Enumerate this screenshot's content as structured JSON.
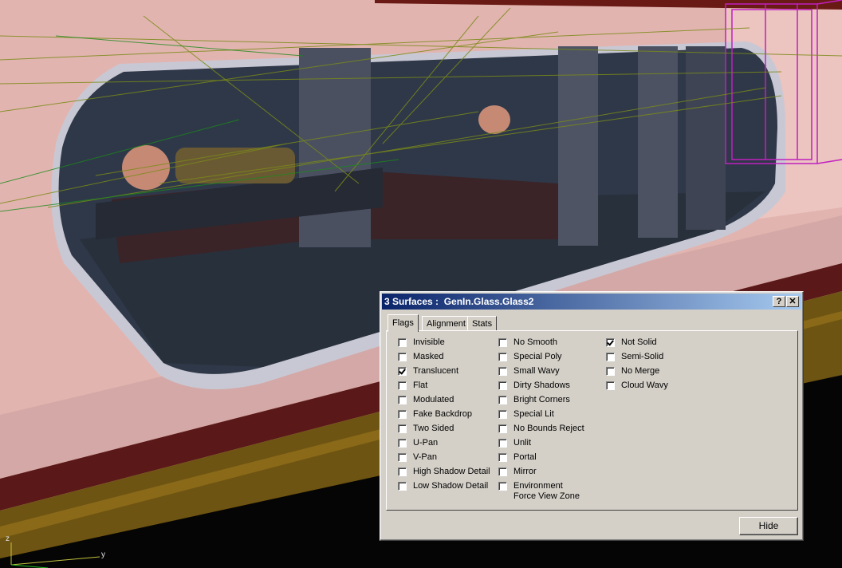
{
  "dialog": {
    "title": "3 Surfaces :  GenIn.Glass.Glass2",
    "help_glyph": "?",
    "close_glyph": "✕",
    "tabs": [
      {
        "label": "Flags",
        "active": true
      },
      {
        "label": "Alignment",
        "active": false
      },
      {
        "label": "Stats",
        "active": false
      }
    ],
    "flags": {
      "column1": [
        {
          "label": "Invisible",
          "checked": false
        },
        {
          "label": "Masked",
          "checked": false
        },
        {
          "label": "Translucent",
          "checked": true
        },
        {
          "label": "Flat",
          "checked": false
        },
        {
          "label": "Modulated",
          "checked": false
        },
        {
          "label": "Fake Backdrop",
          "checked": false
        },
        {
          "label": "Two Sided",
          "checked": false
        },
        {
          "label": "U-Pan",
          "checked": false
        },
        {
          "label": "V-Pan",
          "checked": false
        },
        {
          "label": "High Shadow Detail",
          "checked": false
        },
        {
          "label": "Low Shadow Detail",
          "checked": false
        }
      ],
      "column2": [
        {
          "label": "No Smooth",
          "checked": false
        },
        {
          "label": "Special Poly",
          "checked": false
        },
        {
          "label": "Small Wavy",
          "checked": false
        },
        {
          "label": "Dirty Shadows",
          "checked": false
        },
        {
          "label": "Bright Corners",
          "checked": false
        },
        {
          "label": "Special Lit",
          "checked": false
        },
        {
          "label": "No Bounds Reject",
          "checked": false
        },
        {
          "label": "Unlit",
          "checked": false
        },
        {
          "label": "Portal",
          "checked": false
        },
        {
          "label": "Mirror",
          "checked": false
        },
        {
          "label": "Environment",
          "label2": "Force View Zone",
          "checked": false
        }
      ],
      "column3": [
        {
          "label": "Not Solid",
          "checked": true
        },
        {
          "label": "Semi-Solid",
          "checked": false
        },
        {
          "label": "No Merge",
          "checked": false
        },
        {
          "label": "Cloud Wavy",
          "checked": false
        }
      ]
    },
    "hide_label": "Hide"
  },
  "viewport": {
    "axis_labels": [
      "z",
      "y"
    ]
  },
  "colors": {
    "wall_pink": "#e6b8b4",
    "window_dark": "#2c3442",
    "floor_trim": "#5e4a10",
    "title_blue": "#0a246a",
    "dialog_gray": "#d4d0c8"
  }
}
